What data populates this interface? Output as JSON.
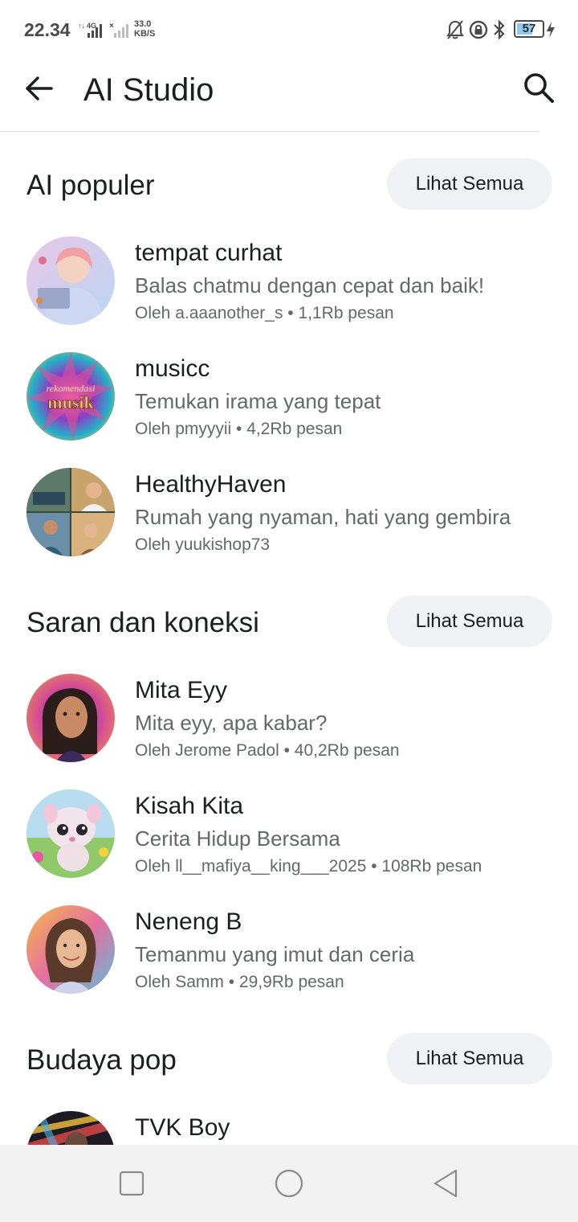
{
  "status_bar": {
    "time": "22.34",
    "network": "4G",
    "speed_value": "33.0",
    "speed_unit": "KB/S",
    "battery": "57"
  },
  "header": {
    "title": "AI Studio",
    "back_icon": "arrow-left-icon",
    "search_icon": "search-icon"
  },
  "sections": [
    {
      "title": "AI populer",
      "see_all": "Lihat Semua",
      "items": [
        {
          "name": "tempat curhat",
          "description": "Balas chatmu dengan cepat dan baik!",
          "meta": "Oleh a.aaanother_s • 1,1Rb pesan"
        },
        {
          "name": "musicc",
          "description": "Temukan irama yang tepat",
          "meta": "Oleh pmyyyii • 4,2Rb pesan",
          "avatar_text_1": "rekomendasi",
          "avatar_text_2": "musik"
        },
        {
          "name": "HealthyHaven",
          "description": "Rumah yang nyaman, hati yang gembira",
          "meta": "Oleh yuukishop73"
        }
      ]
    },
    {
      "title": "Saran dan koneksi",
      "see_all": "Lihat Semua",
      "items": [
        {
          "name": "Mita Eyy",
          "description": "Mita eyy, apa kabar?",
          "meta": "Oleh Jerome Padol • 40,2Rb pesan"
        },
        {
          "name": "Kisah Kita",
          "description": "Cerita Hidup Bersama",
          "meta": "Oleh ll__mafiya__king___2025 • 108Rb pesan"
        },
        {
          "name": "Neneng B",
          "description": "Temanmu yang imut dan ceria",
          "meta": "Oleh Samm • 29,9Rb pesan"
        }
      ]
    },
    {
      "title": "Budaya pop",
      "see_all": "Lihat Semua",
      "items": [
        {
          "name": "TVK Boy",
          "description": "",
          "meta": ""
        }
      ]
    }
  ],
  "nav_bar": {
    "recents_icon": "square-recents-icon",
    "home_icon": "circle-home-icon",
    "back_icon": "triangle-back-icon"
  }
}
